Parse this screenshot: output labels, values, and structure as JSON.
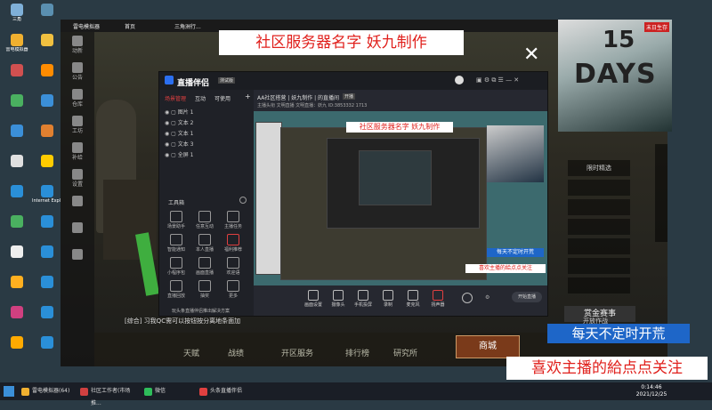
{
  "desktop_icons": [
    {
      "label": "三角",
      "color": "#7fb0d8"
    },
    {
      "label": "",
      "color": "#5a8fb0"
    },
    {
      "label": "雷电模拟器",
      "color": "#f0b030"
    },
    {
      "label": "",
      "color": "#f0c040"
    },
    {
      "label": "",
      "color": "#d05050"
    },
    {
      "label": "",
      "color": "#ff8c00"
    },
    {
      "label": "",
      "color": "#4ab060"
    },
    {
      "label": "",
      "color": "#3b8fd8"
    },
    {
      "label": "",
      "color": "#3b8fd8"
    },
    {
      "label": "",
      "color": "#e08030"
    },
    {
      "label": "",
      "color": "#e0e0e0"
    },
    {
      "label": "",
      "color": "#ffcc00"
    },
    {
      "label": "",
      "color": "#2a8fd8"
    },
    {
      "label": "Internet Explorer",
      "color": "#2a8fd8"
    },
    {
      "label": "",
      "color": "#4ab060"
    },
    {
      "label": "",
      "color": "#2a8fd8"
    },
    {
      "label": "",
      "color": "#eeeeee"
    },
    {
      "label": "",
      "color": "#2a8fd8"
    },
    {
      "label": "",
      "color": "#ffb020"
    },
    {
      "label": "",
      "color": "#2a8fd8"
    },
    {
      "label": "",
      "color": "#d04080"
    },
    {
      "label": "",
      "color": "#2a8fd8"
    },
    {
      "label": "",
      "color": "#ffaa00"
    },
    {
      "label": "",
      "color": "#2a8fd8"
    }
  ],
  "overlay": {
    "title": "社区服务器名字  妖九制作",
    "banner_top": "每天不定时开荒",
    "banner_bottom": "喜欢主播的給点点关注",
    "close": "✕"
  },
  "poster": {
    "num": "15",
    "word": "DAYS",
    "badge": "末日生存"
  },
  "game": {
    "title": "雷电模拟器",
    "tab": "首页",
    "tab2": "三角洲行...",
    "sidebar": [
      "动新",
      "公告",
      "仓库",
      "工坊",
      "补给",
      "设置",
      "",
      "",
      ""
    ],
    "notice": "[综合] 习我QC需可以按钮按分离地条面加",
    "menu": [
      "天赋",
      "战绩",
      "开区服务",
      "排行榜",
      "研究所"
    ],
    "store": "商城",
    "match": "赏金赛事",
    "right_menu": [
      "限时精选",
      "",
      "",
      "",
      "",
      "",
      "",
      "开放作战"
    ]
  },
  "stream": {
    "app_name": "直播伴侣",
    "version": "测试版",
    "tabs": [
      "场景管理",
      "互动",
      "可使用"
    ],
    "room_title": "AA社区搭营 | 妖九制作 | 的直播间",
    "room_tag": "开播",
    "room_meta": "主播头衔   文明直播   文明直播：妖九   ID:3853332   1713",
    "scenes": [
      {
        "name": "图片 1"
      },
      {
        "name": "文本 2"
      },
      {
        "name": "文本 1"
      },
      {
        "name": "文本 3"
      },
      {
        "name": "全屏 1"
      }
    ],
    "tools_title": "工具箱",
    "tools": [
      {
        "label": "场景助手"
      },
      {
        "label": "任意互动"
      },
      {
        "label": "主播任务"
      },
      {
        "label": "智能通知"
      },
      {
        "label": "本人直播"
      },
      {
        "label": "福利推荐"
      },
      {
        "label": "小程序包"
      },
      {
        "label": "画面直播"
      },
      {
        "label": "欢迎语"
      },
      {
        "label": "直播回放"
      },
      {
        "label": "抽奖"
      },
      {
        "label": "更多"
      }
    ],
    "bottom_tip": "玩头条直播伴侣推出解决方案",
    "controls": [
      "画面设置",
      "摄像头",
      "手机投屏",
      "录制",
      "麦克风",
      "扬声器"
    ],
    "start_btn": "开始直播",
    "inner_title": "社区服务器名字  妖九制作",
    "inner_b1": "每天不定时开荒",
    "inner_b2": "喜欢主播的給点点关注"
  },
  "taskbar": {
    "apps": [
      {
        "label": "雷电模拟器(64)",
        "color": "#f0b030"
      },
      {
        "label": "社区工作者(市场推...",
        "color": "#d04040"
      },
      {
        "label": "微信",
        "color": "#2ebd5a"
      },
      {
        "label": "头条直播伴侣",
        "color": "#e04040"
      }
    ],
    "time": "0:14:46",
    "date": "2021/12/25"
  }
}
